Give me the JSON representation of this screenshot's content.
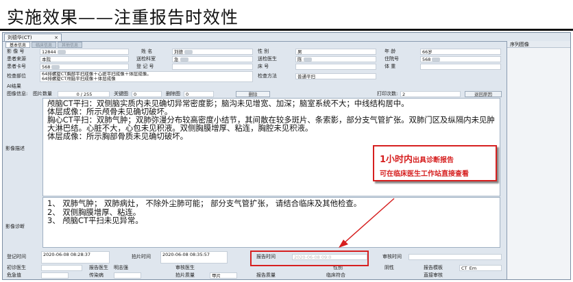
{
  "slide": {
    "title": "实施效果——注重报告时效性"
  },
  "app": {
    "doc_tab": "刘德华(CT)",
    "doc_tab_close": "×",
    "subtabs": [
      "基本信息",
      "临床信息",
      "其他信息"
    ],
    "series_title": "序列图像"
  },
  "form": {
    "row1": {
      "l1": "影 像 号",
      "v1": "12844",
      "l2": "姓    名",
      "v2": "刘德",
      "l3": "性    别",
      "v3": "男",
      "l4": "年    龄",
      "v4": "66岁"
    },
    "row2": {
      "l1": "患者来源",
      "v1": "本院",
      "l2": "送检科室",
      "v2": "急",
      "l3": "送检医生",
      "v3": "陈",
      "l4": "住院号",
      "v4": "568"
    },
    "row3": {
      "l1": "患者卡号",
      "v1": "568",
      "l2": "登 记 号",
      "v2": "",
      "l3": "床    号",
      "v3": "",
      "l4": "体    重",
      "v4": ""
    },
    "row4": {
      "l1": "检查部位",
      "v1a": "64排螺旋CT胸部平扫成像＋心脏平扫成像＋体层成像。",
      "v1b": "64排螺旋CT颅脑平扫成像＋体层成像",
      "l3": "检查方法",
      "v3": "普通平扫"
    },
    "row5": {
      "l1": "AI结果"
    },
    "row6": {
      "l1": "图像信息:",
      "l2": "图片数量",
      "v2": "0 / 255",
      "l3": "关键图",
      "v3": "0",
      "l4": "删除图",
      "v4": "0",
      "btn_delete": "删除",
      "l5": "打印次数:",
      "v5": "2",
      "btn_return": "退回原因"
    }
  },
  "labels": {
    "description": "影像描述",
    "diagnosis": "影像诊断"
  },
  "report": {
    "description": "颅脑CT平扫：双侧脑实质内未见确切异常密度影；脑沟未见增宽、加深；脑室系统不大；中线结构居中。\n体层成像：所示颅骨未见确切破坏。\n胸心CT平扫：双肺气肿；双肺弥漫分布较高密度小结节，其间散在较多斑片、条索影，部分支气管扩张。双肺门区及纵隔内未见肿大淋巴结。心脏不大，心包未见积液。双侧胸膜增厚、粘连，胸腔未见积液。\n体层成像：所示胸部骨质未见确切破坏。",
    "diagnosis": "1、 双肺气肿； 双肺病灶， 不除外尘肺可能； 部分支气管扩张， 请结合临床及其他检查。\n2、 双侧胸膜增厚、粘连。\n3、 颅脑CT平扫未见异常。"
  },
  "bottom": {
    "reg_label": "登记时间",
    "reg_value": "2020-06-08 08:28:37",
    "shot_label": "拍片时间",
    "shot_value": "2020-06-08 08:35:57",
    "report_label": "报告时间",
    "report_value": "2020-06-08 09:0",
    "audit_label": "审核时间",
    "row2": {
      "l1": "初诊医生",
      "l2": "报告医生",
      "l3": "明志强",
      "l4": "审核医生",
      "l5": "性别",
      "l6": "阴性",
      "l7": "报告模板",
      "v7": "CT_Em"
    },
    "row3": {
      "l1": "危急值",
      "l2": "传染病",
      "l3": "拍片质量",
      "v3": "甲片",
      "l4": "报告质量",
      "l5": "临床符合",
      "l6": "直接审核"
    }
  },
  "callout": {
    "line1_big": "1小时内",
    "line1_rest": "出具诊断报告",
    "line2": "可在临床医生工作站直接查看"
  },
  "colors": {
    "accent_red": "#d61f1f",
    "panel_bg": "#dfe6ee"
  }
}
